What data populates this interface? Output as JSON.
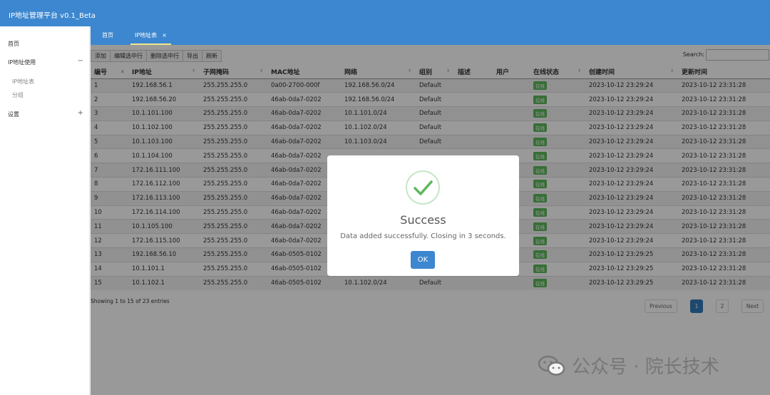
{
  "app": {
    "title": "IP地址管理平台 v0.1_Beta"
  },
  "sidebar": {
    "items": [
      {
        "label": "首页"
      },
      {
        "label": "IP地址使用",
        "toggle": "−"
      },
      {
        "label": "IP地址表"
      },
      {
        "label": "分组"
      },
      {
        "label": "设置",
        "toggle": "+"
      }
    ]
  },
  "tabs": [
    {
      "label": "首页"
    },
    {
      "label": "IP地址表",
      "close": "×"
    }
  ],
  "toolbar": {
    "add": "添加",
    "edit": "编辑选中行",
    "delete": "删除选中行",
    "export": "导出",
    "refresh": "刷新",
    "search_label": "Search:",
    "search_value": ""
  },
  "table": {
    "headers": [
      "编号",
      "IP地址",
      "子网掩码",
      "MAC地址",
      "网络",
      "组别",
      "描述",
      "用户",
      "在线状态",
      "创建时间",
      "更新时间"
    ],
    "rows": [
      [
        "1",
        "192.168.56.1",
        "255.255.255.0",
        "0a00-2700-000f",
        "192.168.56.0/24",
        "Default",
        "",
        "",
        "在线",
        "2023-10-12 23:29:24",
        "2023-10-12 23:31:28"
      ],
      [
        "2",
        "192.168.56.20",
        "255.255.255.0",
        "46ab-0da7-0202",
        "192.168.56.0/24",
        "Default",
        "",
        "",
        "在线",
        "2023-10-12 23:29:24",
        "2023-10-12 23:31:28"
      ],
      [
        "3",
        "10.1.101.100",
        "255.255.255.0",
        "46ab-0da7-0202",
        "10.1.101.0/24",
        "Default",
        "",
        "",
        "在线",
        "2023-10-12 23:29:24",
        "2023-10-12 23:31:28"
      ],
      [
        "4",
        "10.1.102.100",
        "255.255.255.0",
        "46ab-0da7-0202",
        "10.1.102.0/24",
        "Default",
        "",
        "",
        "在线",
        "2023-10-12 23:29:24",
        "2023-10-12 23:31:28"
      ],
      [
        "5",
        "10.1.103.100",
        "255.255.255.0",
        "46ab-0da7-0202",
        "10.1.103.0/24",
        "Default",
        "",
        "",
        "在线",
        "2023-10-12 23:29:24",
        "2023-10-12 23:31:28"
      ],
      [
        "6",
        "10.1.104.100",
        "255.255.255.0",
        "46ab-0da7-0202",
        "",
        "",
        "",
        "",
        "在线",
        "2023-10-12 23:29:24",
        "2023-10-12 23:31:28"
      ],
      [
        "7",
        "172.16.111.100",
        "255.255.255.0",
        "46ab-0da7-0202",
        "",
        "",
        "",
        "",
        "在线",
        "2023-10-12 23:29:24",
        "2023-10-12 23:31:28"
      ],
      [
        "8",
        "172.16.112.100",
        "255.255.255.0",
        "46ab-0da7-0202",
        "",
        "",
        "",
        "",
        "在线",
        "2023-10-12 23:29:24",
        "2023-10-12 23:31:28"
      ],
      [
        "9",
        "172.16.113.100",
        "255.255.255.0",
        "46ab-0da7-0202",
        "",
        "",
        "",
        "",
        "在线",
        "2023-10-12 23:29:24",
        "2023-10-12 23:31:28"
      ],
      [
        "10",
        "172.16.114.100",
        "255.255.255.0",
        "46ab-0da7-0202",
        "",
        "",
        "",
        "",
        "在线",
        "2023-10-12 23:29:24",
        "2023-10-12 23:31:28"
      ],
      [
        "11",
        "10.1.105.100",
        "255.255.255.0",
        "46ab-0da7-0202",
        "",
        "",
        "",
        "",
        "在线",
        "2023-10-12 23:29:24",
        "2023-10-12 23:31:28"
      ],
      [
        "12",
        "172.16.115.100",
        "255.255.255.0",
        "46ab-0da7-0202",
        "",
        "",
        "",
        "",
        "在线",
        "2023-10-12 23:29:24",
        "2023-10-12 23:31:28"
      ],
      [
        "13",
        "192.168.56.10",
        "255.255.255.0",
        "46ab-0505-0102",
        "",
        "",
        "",
        "",
        "在线",
        "2023-10-12 23:29:25",
        "2023-10-12 23:31:28"
      ],
      [
        "14",
        "10.1.101.1",
        "255.255.255.0",
        "46ab-0505-0102",
        "",
        "",
        "",
        "",
        "在线",
        "2023-10-12 23:29:25",
        "2023-10-12 23:31:28"
      ],
      [
        "15",
        "10.1.102.1",
        "255.255.255.0",
        "46ab-0505-0102",
        "10.1.102.0/24",
        "Default",
        "",
        "",
        "在线",
        "2023-10-12 23:29:25",
        "2023-10-12 23:31:28"
      ]
    ]
  },
  "footer": {
    "info": "Showing 1 to 15 of 23 entries",
    "previous": "Previous",
    "page1": "1",
    "page2": "2",
    "next": "Next"
  },
  "modal": {
    "title": "Success",
    "message": "Data added successfully. Closing in 3 seconds.",
    "ok": "OK"
  },
  "watermark": {
    "text": "公众号 · 院长技术"
  },
  "colors": {
    "primary": "#3c87cf",
    "success": "#5cb85c"
  }
}
